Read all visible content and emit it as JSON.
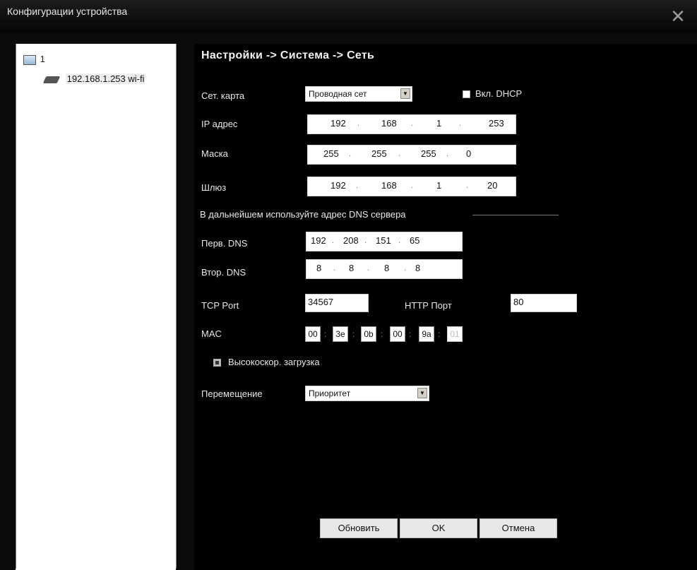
{
  "window": {
    "title": "Конфигурации устройства"
  },
  "tree": {
    "root_label": "1",
    "device_label": "192.168.1.253 wi-fi"
  },
  "breadcrumb": "Настройки -> Система -> Сеть",
  "net_card": {
    "label": "Сет. карта",
    "value": "Проводная сет",
    "dhcp_label": "Вкл. DHCP",
    "dhcp_checked": false
  },
  "ip": {
    "label": "IP адрес",
    "octets": [
      "192",
      "168",
      "1",
      "253"
    ]
  },
  "mask": {
    "label": "Маска",
    "octets": [
      "255",
      "255",
      "255",
      "0"
    ]
  },
  "gateway": {
    "label": "Шлюз",
    "octets": [
      "192",
      "168",
      "1",
      "20"
    ]
  },
  "dns_heading": "В дальнейшем используйте адрес DNS сервера",
  "dns1": {
    "label": "Перв. DNS",
    "octets": [
      "192",
      "208",
      "151",
      "65"
    ]
  },
  "dns2": {
    "label": "Втор. DNS",
    "octets": [
      "8",
      "8",
      "8",
      "8"
    ]
  },
  "tcp_port": {
    "label": "TCP Port",
    "value": "34567"
  },
  "http_port": {
    "label": "HTTP Порт",
    "value": "80"
  },
  "mac": {
    "label": "MAC",
    "parts": [
      "00",
      "3e",
      "0b",
      "00",
      "9a",
      "01"
    ]
  },
  "high_speed": {
    "label": "Высокоскор. загрузка",
    "checked": true
  },
  "transfer": {
    "label": "Перемещение",
    "value": "Приоритет"
  },
  "buttons": {
    "refresh": "Обновить",
    "ok": "OK",
    "cancel": "Отмена"
  },
  "colors": {
    "panel_bg": "#000000",
    "label_text": "#e8e8e8",
    "title_bg": "#0b0b0b"
  },
  "icons": {
    "close": "close-icon",
    "tree_root": "computer-icon",
    "device": "camera-icon"
  }
}
